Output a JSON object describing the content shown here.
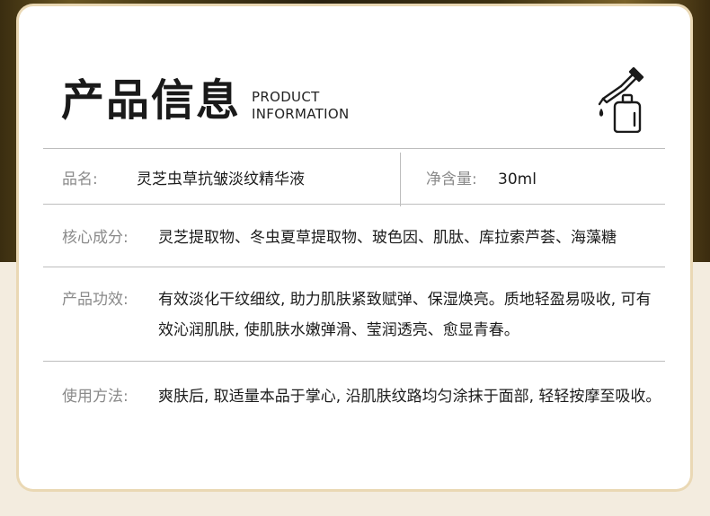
{
  "header": {
    "title_cn": "产品信息",
    "title_en_line1": "PRODUCT",
    "title_en_line2": "INFORMATION"
  },
  "icons": {
    "header_icon": "dropper-bottle-icon"
  },
  "rows": {
    "name": {
      "label": "品名:",
      "value": "灵芝虫草抗皱淡纹精华液"
    },
    "volume": {
      "label": "净含量:",
      "value": "30ml"
    },
    "ingredients": {
      "label": "核心成分:",
      "value": "灵芝提取物、冬虫夏草提取物、玻色因、肌肽、库拉索芦荟、海藻糖"
    },
    "effects": {
      "label": "产品功效:",
      "value": "有效淡化干纹细纹, 助力肌肤紧致赋弹、保湿焕亮。质地轻盈易吸收, 可有效沁润肌肤, 使肌肤水嫩弹滑、莹润透亮、愈显青春。"
    },
    "usage": {
      "label": "使用方法:",
      "value": "爽肤后, 取适量本品于掌心, 沿肌肤纹路均匀涂抹于面部, 轻轻按摩至吸收。"
    }
  }
}
